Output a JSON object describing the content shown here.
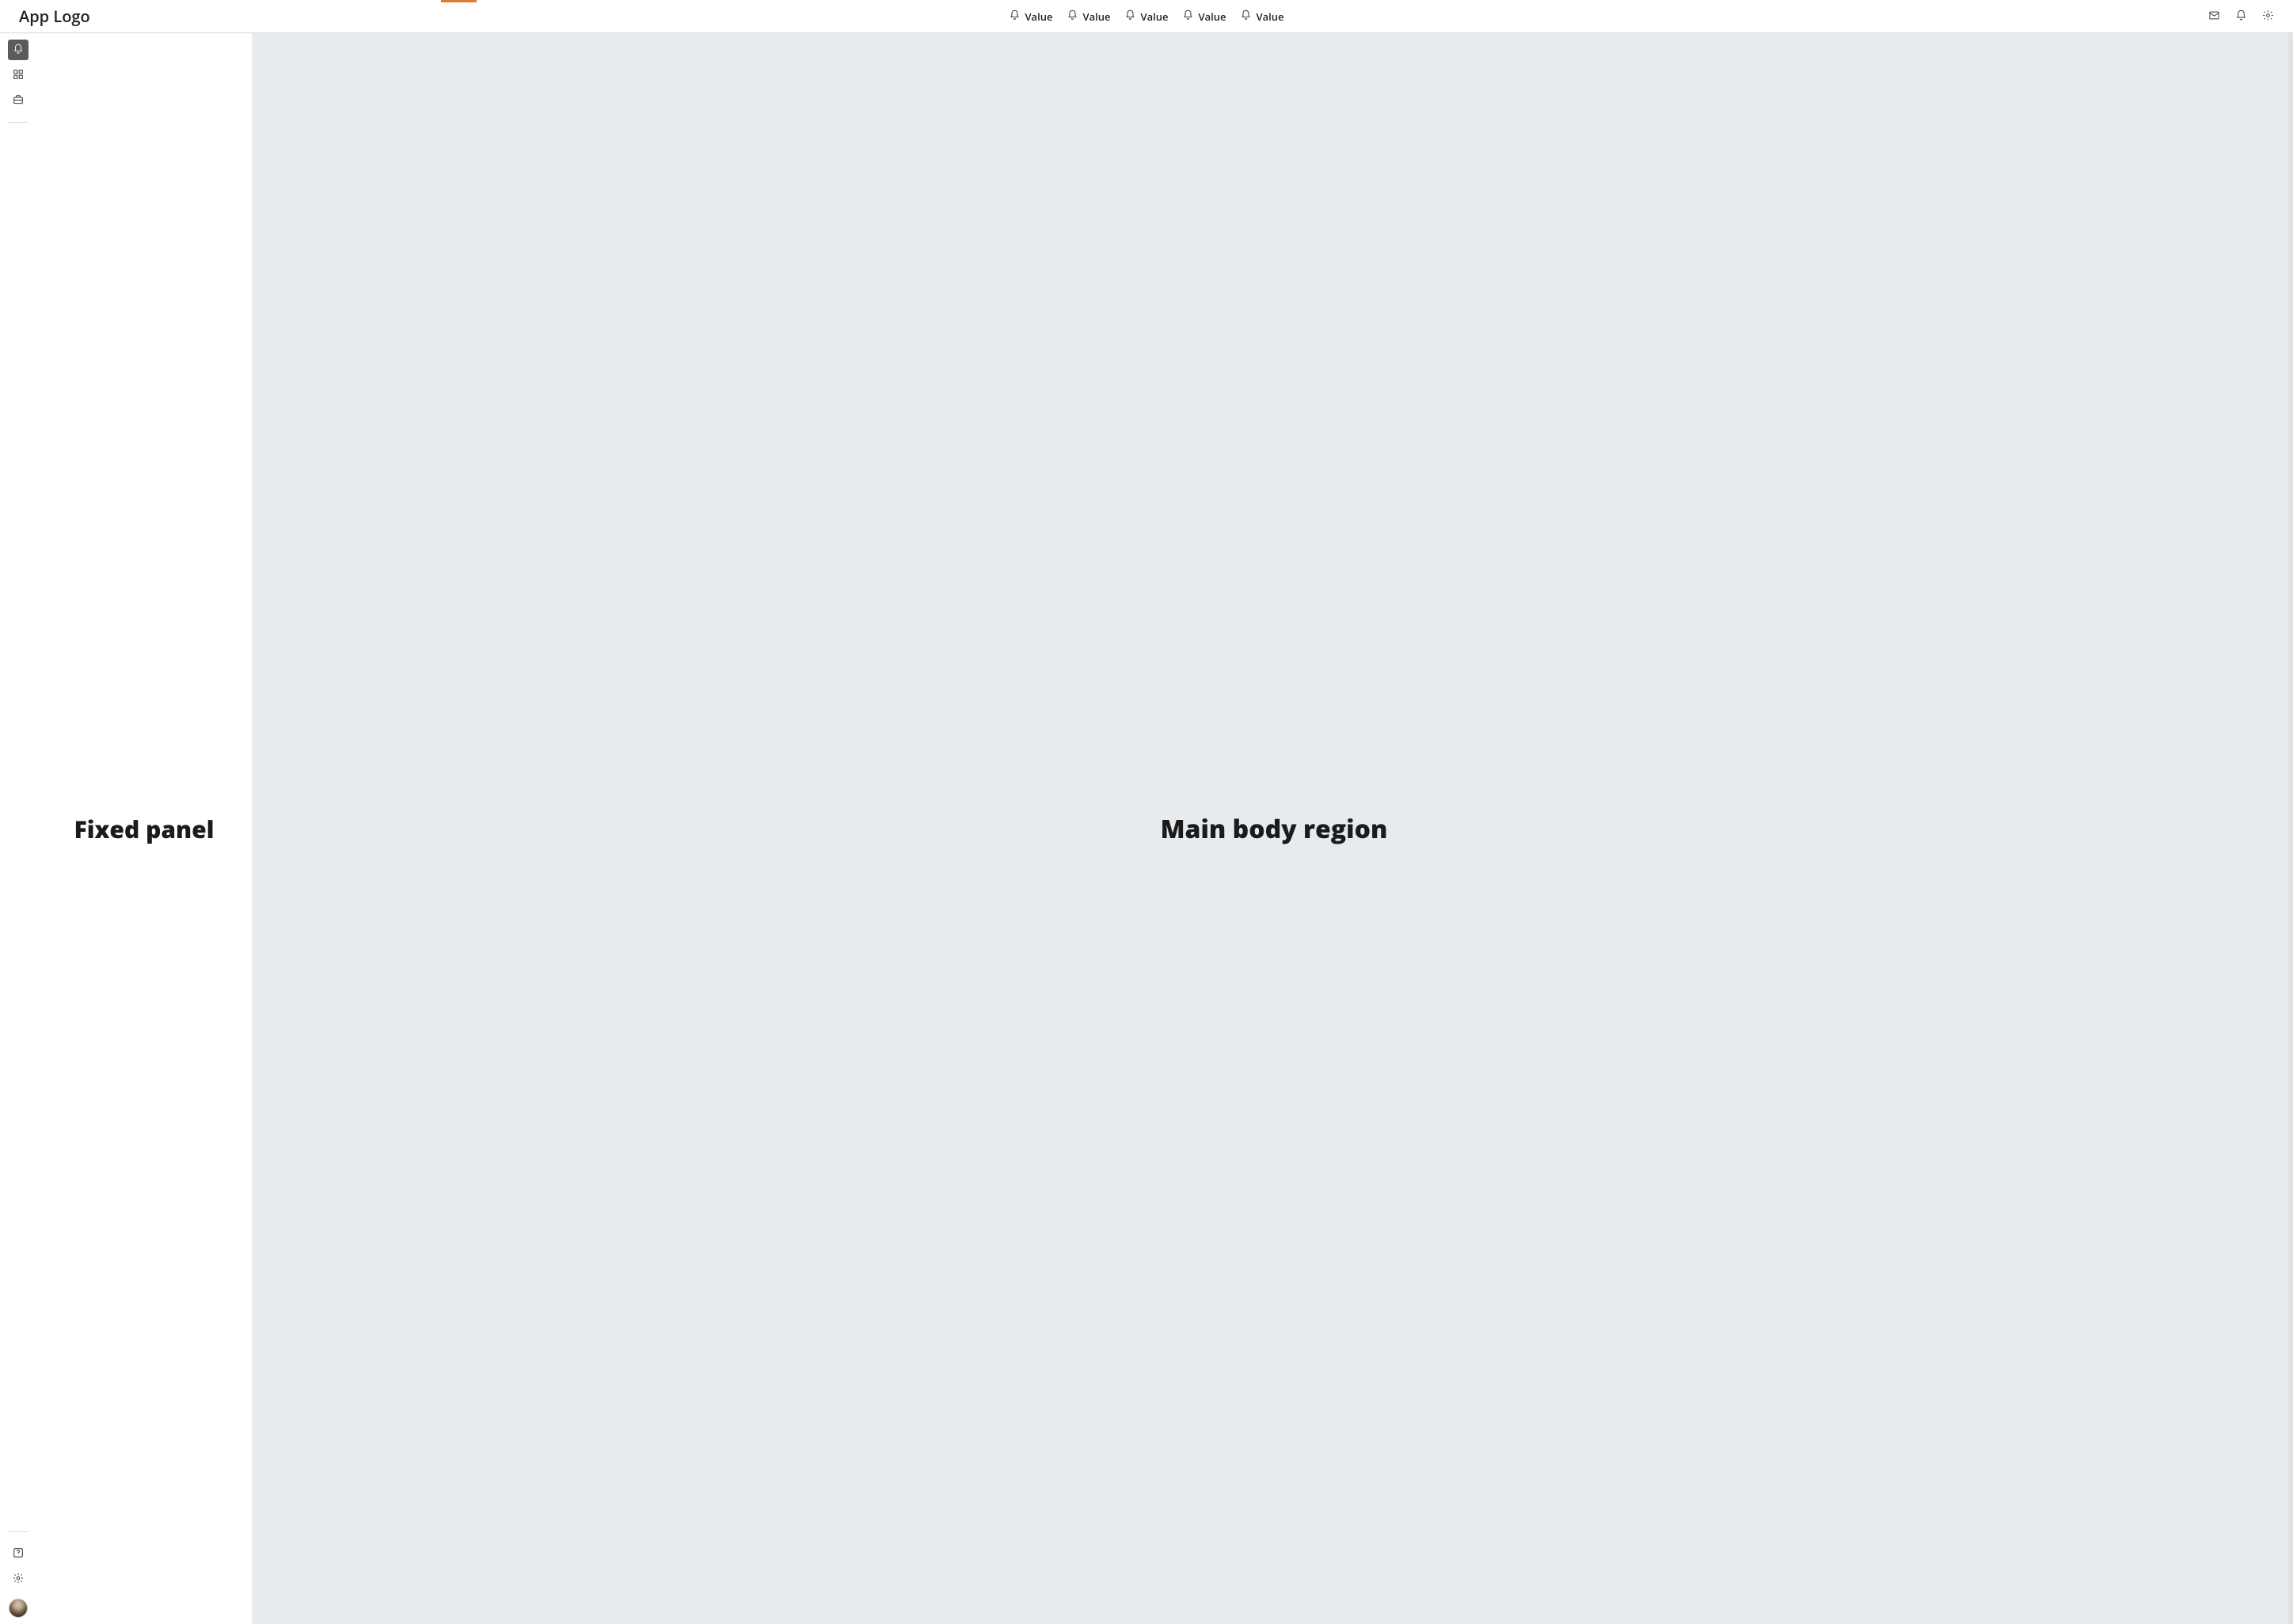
{
  "header": {
    "logo_text": "App Logo",
    "nav_items": [
      {
        "label": "Value"
      },
      {
        "label": "Value"
      },
      {
        "label": "Value"
      },
      {
        "label": "Value"
      },
      {
        "label": "Value"
      }
    ],
    "accent_color": "#e07a2e"
  },
  "rail": {
    "top_items": [
      {
        "name": "bell-icon",
        "active": true
      },
      {
        "name": "grid-icon",
        "active": false
      },
      {
        "name": "briefcase-icon",
        "active": false
      }
    ],
    "bottom_items": [
      {
        "name": "help-icon"
      },
      {
        "name": "gear-icon"
      }
    ]
  },
  "fixed_panel": {
    "title": "Fixed panel"
  },
  "main": {
    "title": "Main body region"
  }
}
